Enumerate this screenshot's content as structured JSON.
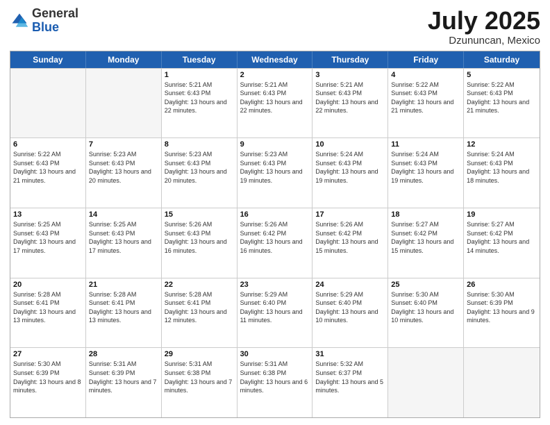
{
  "header": {
    "logo_general": "General",
    "logo_blue": "Blue",
    "month_title": "July 2025",
    "location": "Dzununcan, Mexico"
  },
  "weekdays": [
    "Sunday",
    "Monday",
    "Tuesday",
    "Wednesday",
    "Thursday",
    "Friday",
    "Saturday"
  ],
  "rows": [
    [
      {
        "day": "",
        "sunrise": "",
        "sunset": "",
        "daylight": "",
        "empty": true
      },
      {
        "day": "",
        "sunrise": "",
        "sunset": "",
        "daylight": "",
        "empty": true
      },
      {
        "day": "1",
        "sunrise": "Sunrise: 5:21 AM",
        "sunset": "Sunset: 6:43 PM",
        "daylight": "Daylight: 13 hours and 22 minutes."
      },
      {
        "day": "2",
        "sunrise": "Sunrise: 5:21 AM",
        "sunset": "Sunset: 6:43 PM",
        "daylight": "Daylight: 13 hours and 22 minutes."
      },
      {
        "day": "3",
        "sunrise": "Sunrise: 5:21 AM",
        "sunset": "Sunset: 6:43 PM",
        "daylight": "Daylight: 13 hours and 22 minutes."
      },
      {
        "day": "4",
        "sunrise": "Sunrise: 5:22 AM",
        "sunset": "Sunset: 6:43 PM",
        "daylight": "Daylight: 13 hours and 21 minutes."
      },
      {
        "day": "5",
        "sunrise": "Sunrise: 5:22 AM",
        "sunset": "Sunset: 6:43 PM",
        "daylight": "Daylight: 13 hours and 21 minutes."
      }
    ],
    [
      {
        "day": "6",
        "sunrise": "Sunrise: 5:22 AM",
        "sunset": "Sunset: 6:43 PM",
        "daylight": "Daylight: 13 hours and 21 minutes."
      },
      {
        "day": "7",
        "sunrise": "Sunrise: 5:23 AM",
        "sunset": "Sunset: 6:43 PM",
        "daylight": "Daylight: 13 hours and 20 minutes."
      },
      {
        "day": "8",
        "sunrise": "Sunrise: 5:23 AM",
        "sunset": "Sunset: 6:43 PM",
        "daylight": "Daylight: 13 hours and 20 minutes."
      },
      {
        "day": "9",
        "sunrise": "Sunrise: 5:23 AM",
        "sunset": "Sunset: 6:43 PM",
        "daylight": "Daylight: 13 hours and 19 minutes."
      },
      {
        "day": "10",
        "sunrise": "Sunrise: 5:24 AM",
        "sunset": "Sunset: 6:43 PM",
        "daylight": "Daylight: 13 hours and 19 minutes."
      },
      {
        "day": "11",
        "sunrise": "Sunrise: 5:24 AM",
        "sunset": "Sunset: 6:43 PM",
        "daylight": "Daylight: 13 hours and 19 minutes."
      },
      {
        "day": "12",
        "sunrise": "Sunrise: 5:24 AM",
        "sunset": "Sunset: 6:43 PM",
        "daylight": "Daylight: 13 hours and 18 minutes."
      }
    ],
    [
      {
        "day": "13",
        "sunrise": "Sunrise: 5:25 AM",
        "sunset": "Sunset: 6:43 PM",
        "daylight": "Daylight: 13 hours and 17 minutes."
      },
      {
        "day": "14",
        "sunrise": "Sunrise: 5:25 AM",
        "sunset": "Sunset: 6:43 PM",
        "daylight": "Daylight: 13 hours and 17 minutes."
      },
      {
        "day": "15",
        "sunrise": "Sunrise: 5:26 AM",
        "sunset": "Sunset: 6:43 PM",
        "daylight": "Daylight: 13 hours and 16 minutes."
      },
      {
        "day": "16",
        "sunrise": "Sunrise: 5:26 AM",
        "sunset": "Sunset: 6:42 PM",
        "daylight": "Daylight: 13 hours and 16 minutes."
      },
      {
        "day": "17",
        "sunrise": "Sunrise: 5:26 AM",
        "sunset": "Sunset: 6:42 PM",
        "daylight": "Daylight: 13 hours and 15 minutes."
      },
      {
        "day": "18",
        "sunrise": "Sunrise: 5:27 AM",
        "sunset": "Sunset: 6:42 PM",
        "daylight": "Daylight: 13 hours and 15 minutes."
      },
      {
        "day": "19",
        "sunrise": "Sunrise: 5:27 AM",
        "sunset": "Sunset: 6:42 PM",
        "daylight": "Daylight: 13 hours and 14 minutes."
      }
    ],
    [
      {
        "day": "20",
        "sunrise": "Sunrise: 5:28 AM",
        "sunset": "Sunset: 6:41 PM",
        "daylight": "Daylight: 13 hours and 13 minutes."
      },
      {
        "day": "21",
        "sunrise": "Sunrise: 5:28 AM",
        "sunset": "Sunset: 6:41 PM",
        "daylight": "Daylight: 13 hours and 13 minutes."
      },
      {
        "day": "22",
        "sunrise": "Sunrise: 5:28 AM",
        "sunset": "Sunset: 6:41 PM",
        "daylight": "Daylight: 13 hours and 12 minutes."
      },
      {
        "day": "23",
        "sunrise": "Sunrise: 5:29 AM",
        "sunset": "Sunset: 6:40 PM",
        "daylight": "Daylight: 13 hours and 11 minutes."
      },
      {
        "day": "24",
        "sunrise": "Sunrise: 5:29 AM",
        "sunset": "Sunset: 6:40 PM",
        "daylight": "Daylight: 13 hours and 10 minutes."
      },
      {
        "day": "25",
        "sunrise": "Sunrise: 5:30 AM",
        "sunset": "Sunset: 6:40 PM",
        "daylight": "Daylight: 13 hours and 10 minutes."
      },
      {
        "day": "26",
        "sunrise": "Sunrise: 5:30 AM",
        "sunset": "Sunset: 6:39 PM",
        "daylight": "Daylight: 13 hours and 9 minutes."
      }
    ],
    [
      {
        "day": "27",
        "sunrise": "Sunrise: 5:30 AM",
        "sunset": "Sunset: 6:39 PM",
        "daylight": "Daylight: 13 hours and 8 minutes."
      },
      {
        "day": "28",
        "sunrise": "Sunrise: 5:31 AM",
        "sunset": "Sunset: 6:39 PM",
        "daylight": "Daylight: 13 hours and 7 minutes."
      },
      {
        "day": "29",
        "sunrise": "Sunrise: 5:31 AM",
        "sunset": "Sunset: 6:38 PM",
        "daylight": "Daylight: 13 hours and 7 minutes."
      },
      {
        "day": "30",
        "sunrise": "Sunrise: 5:31 AM",
        "sunset": "Sunset: 6:38 PM",
        "daylight": "Daylight: 13 hours and 6 minutes."
      },
      {
        "day": "31",
        "sunrise": "Sunrise: 5:32 AM",
        "sunset": "Sunset: 6:37 PM",
        "daylight": "Daylight: 13 hours and 5 minutes."
      },
      {
        "day": "",
        "sunrise": "",
        "sunset": "",
        "daylight": "",
        "empty": true
      },
      {
        "day": "",
        "sunrise": "",
        "sunset": "",
        "daylight": "",
        "empty": true
      }
    ]
  ]
}
